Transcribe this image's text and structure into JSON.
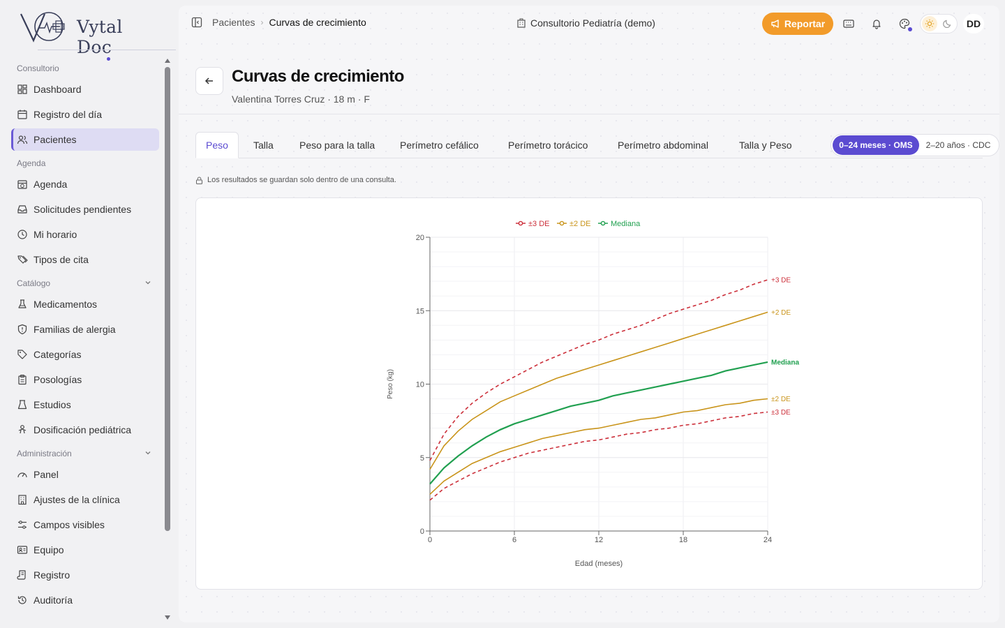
{
  "app": {
    "logo_text": "Vytal Doc"
  },
  "sidebar": {
    "sections": [
      {
        "label": "Consultorio",
        "items": [
          {
            "label": "Dashboard",
            "icon": "dashboard-icon"
          },
          {
            "label": "Registro del día",
            "icon": "calendar-icon"
          },
          {
            "label": "Pacientes",
            "icon": "users-icon",
            "active": true
          }
        ]
      },
      {
        "label": "Agenda",
        "items": [
          {
            "label": "Agenda",
            "icon": "calendar-clock-icon"
          },
          {
            "label": "Solicitudes pendientes",
            "icon": "inbox-icon"
          },
          {
            "label": "Mi horario",
            "icon": "clock-icon"
          },
          {
            "label": "Tipos de cita",
            "icon": "tags-icon"
          }
        ]
      },
      {
        "label": "Catálogo",
        "collapsible": true,
        "items": [
          {
            "label": "Medicamentos",
            "icon": "flask-icon"
          },
          {
            "label": "Familias de alergia",
            "icon": "shield-alert-icon"
          },
          {
            "label": "Categorías",
            "icon": "tag-icon"
          },
          {
            "label": "Posologías",
            "icon": "clipboard-icon"
          },
          {
            "label": "Estudios",
            "icon": "beaker-icon"
          },
          {
            "label": "Dosificación pediátrica",
            "icon": "baby-icon"
          }
        ]
      },
      {
        "label": "Administración",
        "collapsible": true,
        "items": [
          {
            "label": "Panel",
            "icon": "gauge-icon"
          },
          {
            "label": "Ajustes de la clínica",
            "icon": "building-icon"
          },
          {
            "label": "Campos visibles",
            "icon": "sliders-icon"
          },
          {
            "label": "Equipo",
            "icon": "id-card-icon"
          },
          {
            "label": "Registro",
            "icon": "scroll-icon"
          },
          {
            "label": "Auditoría",
            "icon": "history-icon"
          }
        ]
      }
    ]
  },
  "topbar": {
    "breadcrumb_parent": "Pacientes",
    "breadcrumb_current": "Curvas de crecimiento",
    "clinic_name": "Consultorio Pediatría (demo)",
    "report_label": "Reportar",
    "avatar_initials": "DD"
  },
  "header": {
    "title": "Curvas de crecimiento",
    "subtitle": "Valentina Torres Cruz · 18 m · F"
  },
  "tabs": [
    {
      "label": "Peso",
      "active": true
    },
    {
      "label": "Talla"
    },
    {
      "label": "Peso para la talla"
    },
    {
      "label": "Perímetro cefálico"
    },
    {
      "label": "Perímetro torácico"
    },
    {
      "label": "Perímetro abdominal"
    },
    {
      "label": "Talla y Peso"
    }
  ],
  "range_toggle": {
    "selected": "0–24 meses · OMS",
    "other": "2–20 años · CDC"
  },
  "notice": "Los resultados se guardan solo dentro de una consulta.",
  "colors": {
    "accent": "#5b4bd1",
    "report": "#f29b2a",
    "sd3": "#cc2f3a",
    "sd2": "#c9941a",
    "median": "#21a050"
  },
  "chart_data": {
    "type": "line",
    "xlabel": "Edad (meses)",
    "ylabel": "Peso (kg)",
    "xlim": [
      0,
      24
    ],
    "ylim": [
      0,
      20
    ],
    "xticks": [
      0,
      6,
      12,
      18,
      24
    ],
    "yticks": [
      0,
      5,
      10,
      15,
      20
    ],
    "grid": true,
    "legend_position": "top-center",
    "legend": [
      {
        "label": "±3 DE",
        "color": "#cc2f3a"
      },
      {
        "label": "±2 DE",
        "color": "#c9941a"
      },
      {
        "label": "Mediana",
        "color": "#21a050"
      }
    ],
    "x": [
      0,
      1,
      2,
      3,
      4,
      5,
      6,
      7,
      8,
      9,
      10,
      11,
      12,
      13,
      14,
      15,
      16,
      17,
      18,
      19,
      20,
      21,
      22,
      23,
      24
    ],
    "series": [
      {
        "name": "+3 DE",
        "style": "dashed",
        "color": "#cc2f3a",
        "values": [
          4.8,
          6.6,
          7.8,
          8.7,
          9.4,
          10.0,
          10.5,
          11.0,
          11.5,
          11.9,
          12.3,
          12.7,
          13.0,
          13.4,
          13.7,
          14.0,
          14.4,
          14.8,
          15.1,
          15.4,
          15.7,
          16.1,
          16.4,
          16.8,
          17.1
        ]
      },
      {
        "name": "+2 DE",
        "style": "solid",
        "color": "#c9941a",
        "values": [
          4.2,
          5.8,
          6.8,
          7.6,
          8.2,
          8.8,
          9.2,
          9.6,
          10.0,
          10.4,
          10.7,
          11.0,
          11.3,
          11.6,
          11.9,
          12.2,
          12.5,
          12.8,
          13.1,
          13.4,
          13.7,
          14.0,
          14.3,
          14.6,
          14.9
        ]
      },
      {
        "name": "Mediana",
        "style": "solid",
        "color": "#21a050",
        "values": [
          3.2,
          4.3,
          5.1,
          5.8,
          6.4,
          6.9,
          7.3,
          7.6,
          7.9,
          8.2,
          8.5,
          8.7,
          8.9,
          9.2,
          9.4,
          9.6,
          9.8,
          10.0,
          10.2,
          10.4,
          10.6,
          10.9,
          11.1,
          11.3,
          11.5
        ]
      },
      {
        "name": "-2 DE",
        "style": "solid",
        "color": "#c9941a",
        "values": [
          2.5,
          3.4,
          4.0,
          4.6,
          5.0,
          5.4,
          5.7,
          6.0,
          6.3,
          6.5,
          6.7,
          6.9,
          7.0,
          7.2,
          7.4,
          7.6,
          7.7,
          7.9,
          8.1,
          8.2,
          8.4,
          8.6,
          8.7,
          8.9,
          9.0
        ]
      },
      {
        "name": "-3 DE",
        "style": "dashed",
        "color": "#cc2f3a",
        "values": [
          2.1,
          2.9,
          3.4,
          3.9,
          4.3,
          4.7,
          5.0,
          5.3,
          5.5,
          5.7,
          5.9,
          6.1,
          6.2,
          6.4,
          6.6,
          6.7,
          6.9,
          7.0,
          7.2,
          7.3,
          7.5,
          7.7,
          7.8,
          8.0,
          8.1
        ]
      }
    ],
    "end_labels": [
      "+3 DE",
      "+2 DE",
      "Mediana",
      "±2 DE",
      "±3 DE"
    ]
  }
}
